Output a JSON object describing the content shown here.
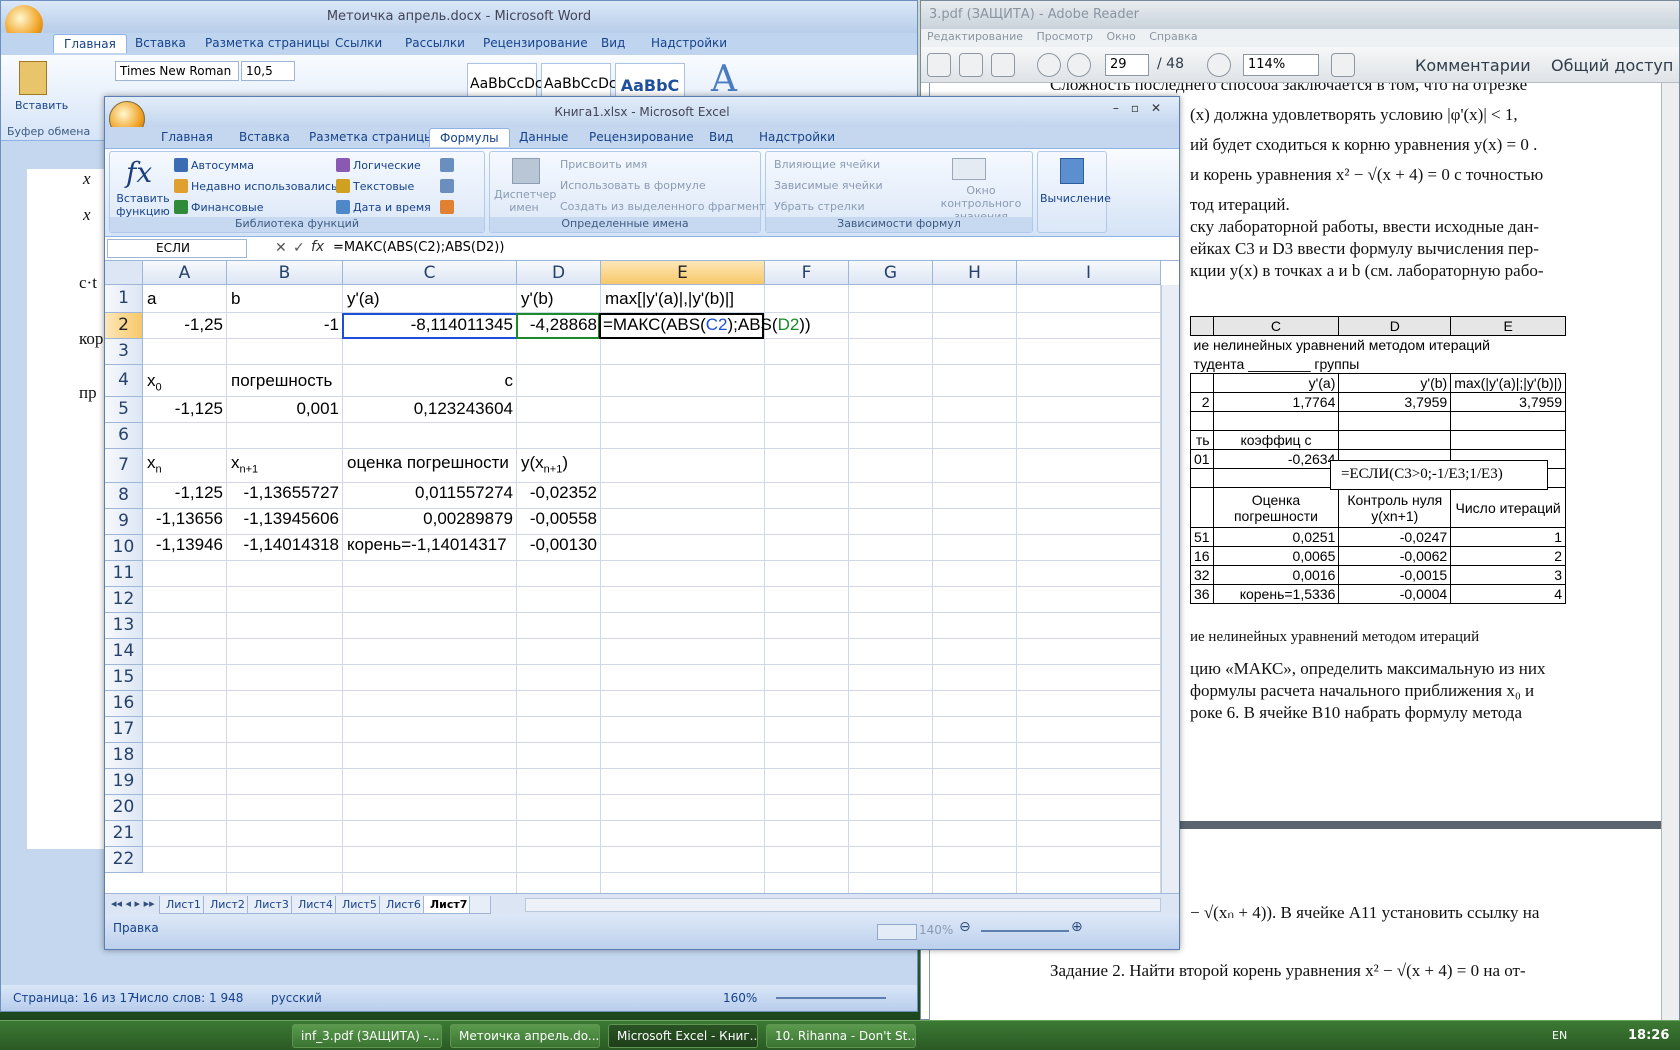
{
  "reader": {
    "title": "3.pdf (ЗАЩИТА) - Adobe Reader",
    "menu": [
      "Редактирование",
      "Просмотр",
      "Окно",
      "Справка"
    ],
    "page": "29",
    "page_total": "/ 48",
    "zoom": "114%",
    "comments": "Комментарии",
    "share": "Общий доступ",
    "lines": [
      "Сложность последнего способа заключается в том, что на отрезке",
      "(x)  должна  удовлетворять  условию  |φ'(x)| < 1,",
      "ий будет сходиться к корню уравнения  y(x) = 0 .",
      "и корень уравнения  x² − √(x + 4) = 0  с точностью",
      "тод итераций.",
      "ску лабораторной работы, ввести исходные дан-",
      "ейках C3 и D3 ввести формулу вычисления пер-",
      "кции y(x) в точках a и b (см. лабораторную рабо-"
    ],
    "table_header": [
      "C",
      "D",
      "E"
    ],
    "table_title": "ие нелинейных уравнений  методом итераций",
    "table_sub": "тудента ________ группы",
    "table_rows": [
      [
        "",
        "y'(a)",
        "y'(b)",
        "max(|y'(a)|;|y'(b)|)"
      ],
      [
        "2",
        "1,7764",
        "3,7959",
        "3,7959"
      ],
      [
        "ть",
        "коэффиц c",
        "",
        ""
      ],
      [
        "01",
        "-0,2634",
        "",
        ""
      ],
      [
        "",
        "Оценка погрешности",
        "Контроль нуля y(xn+1)",
        "Число итераций"
      ],
      [
        "51",
        "0,0251",
        "-0,0247",
        "1"
      ],
      [
        "16",
        "0,0065",
        "-0,0062",
        "2"
      ],
      [
        "32",
        "0,0016",
        "-0,0015",
        "3"
      ],
      [
        "36",
        "корень=1,5336",
        "-0,0004",
        "4"
      ]
    ],
    "callout": "=ЕСЛИ(C3>0;-1/E3;1/E3)",
    "caption": "ие нелинейных уравнений методом итераций",
    "lines2": [
      "цию «МАКС», определить максимальную из них",
      "формулы расчета начального приближения x₀ и",
      "роке 6. В ячейке B10 набрать формулу метода"
    ],
    "line3": "− √(xₙ + 4)). В ячейке A11 установить ссылку на",
    "line4": "Задание 2. Найти второй корень уравнения  x² − √(x + 4) = 0  на от-"
  },
  "word": {
    "title": "Метоичка апрель.docx - Microsoft Word",
    "tabs": [
      "Главная",
      "Вставка",
      "Разметка страницы",
      "Ссылки",
      "Рассылки",
      "Рецензирование",
      "Вид",
      "Надстройки"
    ],
    "font": "Times New Roman",
    "size": "10,5",
    "paste": "Вставить",
    "clipboard": "Буфер обмена",
    "styles": [
      "AaBbCcDc",
      "AaBbCcDc",
      "AaBbC"
    ],
    "page_text": [
      "x",
      "x",
      "c·t",
      "кор",
      "пр"
    ],
    "status": {
      "page": "Страница: 16 из 17",
      "words": "Число слов: 1 948",
      "lang": "русский",
      "zoom": "160%"
    }
  },
  "excel": {
    "title": "Книга1.xlsx - Microsoft Excel",
    "tabs": [
      "Главная",
      "Вставка",
      "Разметка страницы",
      "Формулы",
      "Данные",
      "Рецензирование",
      "Вид",
      "Надстройки"
    ],
    "active_tab": "Формулы",
    "ribbon": {
      "insert_fn": "Вставить функцию",
      "autosum": "Автосумма",
      "recent": "Недавно использовались",
      "financial": "Финансовые",
      "logical": "Логические",
      "text": "Текстовые",
      "datetime": "Дата и время",
      "group1": "Библиотека функций",
      "dispatcher": "Диспетчер имен",
      "assign_name": "Присвоить имя",
      "use_in_formula": "Использовать в формуле",
      "create_from_sel": "Создать из выделенного фрагмента",
      "group2": "Определенные имена",
      "precedents": "Влияющие ячейки",
      "dependents": "Зависимые ячейки",
      "remove_arrows": "Убрать стрелки",
      "watch": "Окно контрольного значения",
      "group3": "Зависимости формул",
      "calc": "Вычисление"
    },
    "namebox": "ЕСЛИ",
    "formula": "=МАКС(ABS(C2);ABS(D2))",
    "columns": [
      "A",
      "B",
      "C",
      "D",
      "E",
      "F",
      "G",
      "H",
      "I"
    ],
    "rows": [
      "1",
      "2",
      "3",
      "4",
      "5",
      "6",
      "7",
      "8",
      "9",
      "10",
      "11",
      "12",
      "13",
      "14",
      "15",
      "16",
      "17",
      "18",
      "19",
      "20",
      "21",
      "22"
    ],
    "cells": {
      "A1": "a",
      "B1": "b",
      "C1": "y'(a)",
      "D1": "y'(b)",
      "E1": "max[|y'(a)|,|y'(b)|]",
      "A2": "-1,25",
      "B2": "-1",
      "C2": "-8,114011345",
      "D2": "-4,28868",
      "E2_pre": "=МАКС(ABS(",
      "E2_c2": "C2",
      "E2_mid": ");ABS(",
      "E2_d2": "D2",
      "E2_post": "))",
      "A4": "x",
      "A4_sub": "0",
      "B4": "погрешность",
      "C4": "c",
      "A5": "-1,125",
      "B5": "0,001",
      "C5": "0,123243604",
      "A7": "x",
      "A7_sub": "n",
      "B7": "x",
      "B7_sub": "n+1",
      "C7": "оценка погрешности",
      "D7": "y(x",
      "D7_sub": "n+1",
      "D7_post": ")",
      "A8": "-1,125",
      "B8": "-1,13655727",
      "C8": "0,011557274",
      "D8": "-0,02352",
      "A9": "-1,13656",
      "B9": "-1,13945606",
      "C9": "0,00289879",
      "D9": "-0,00558",
      "A10": "-1,13946",
      "B10": "-1,14014318",
      "C10": "корень=-1,14014317",
      "D10": "-0,00130"
    },
    "sheets": [
      "Лист1",
      "Лист2",
      "Лист3",
      "Лист4",
      "Лист5",
      "Лист6",
      "Лист7"
    ],
    "active_sheet": "Лист7",
    "status": "Правка",
    "zoom": "140%"
  },
  "taskbar": {
    "items": [
      "inf_3.pdf (ЗАЩИТА) -...",
      "Метоичка апрель.do...",
      "Microsoft Excel - Книг...",
      "10. Rihanna - Don't St..."
    ],
    "lang": "EN",
    "clock": "18:26"
  },
  "colors": {
    "ref_blue": "#1f4fd8",
    "ref_green": "#1a8a2a",
    "ribbon_blue": "#15428b"
  }
}
